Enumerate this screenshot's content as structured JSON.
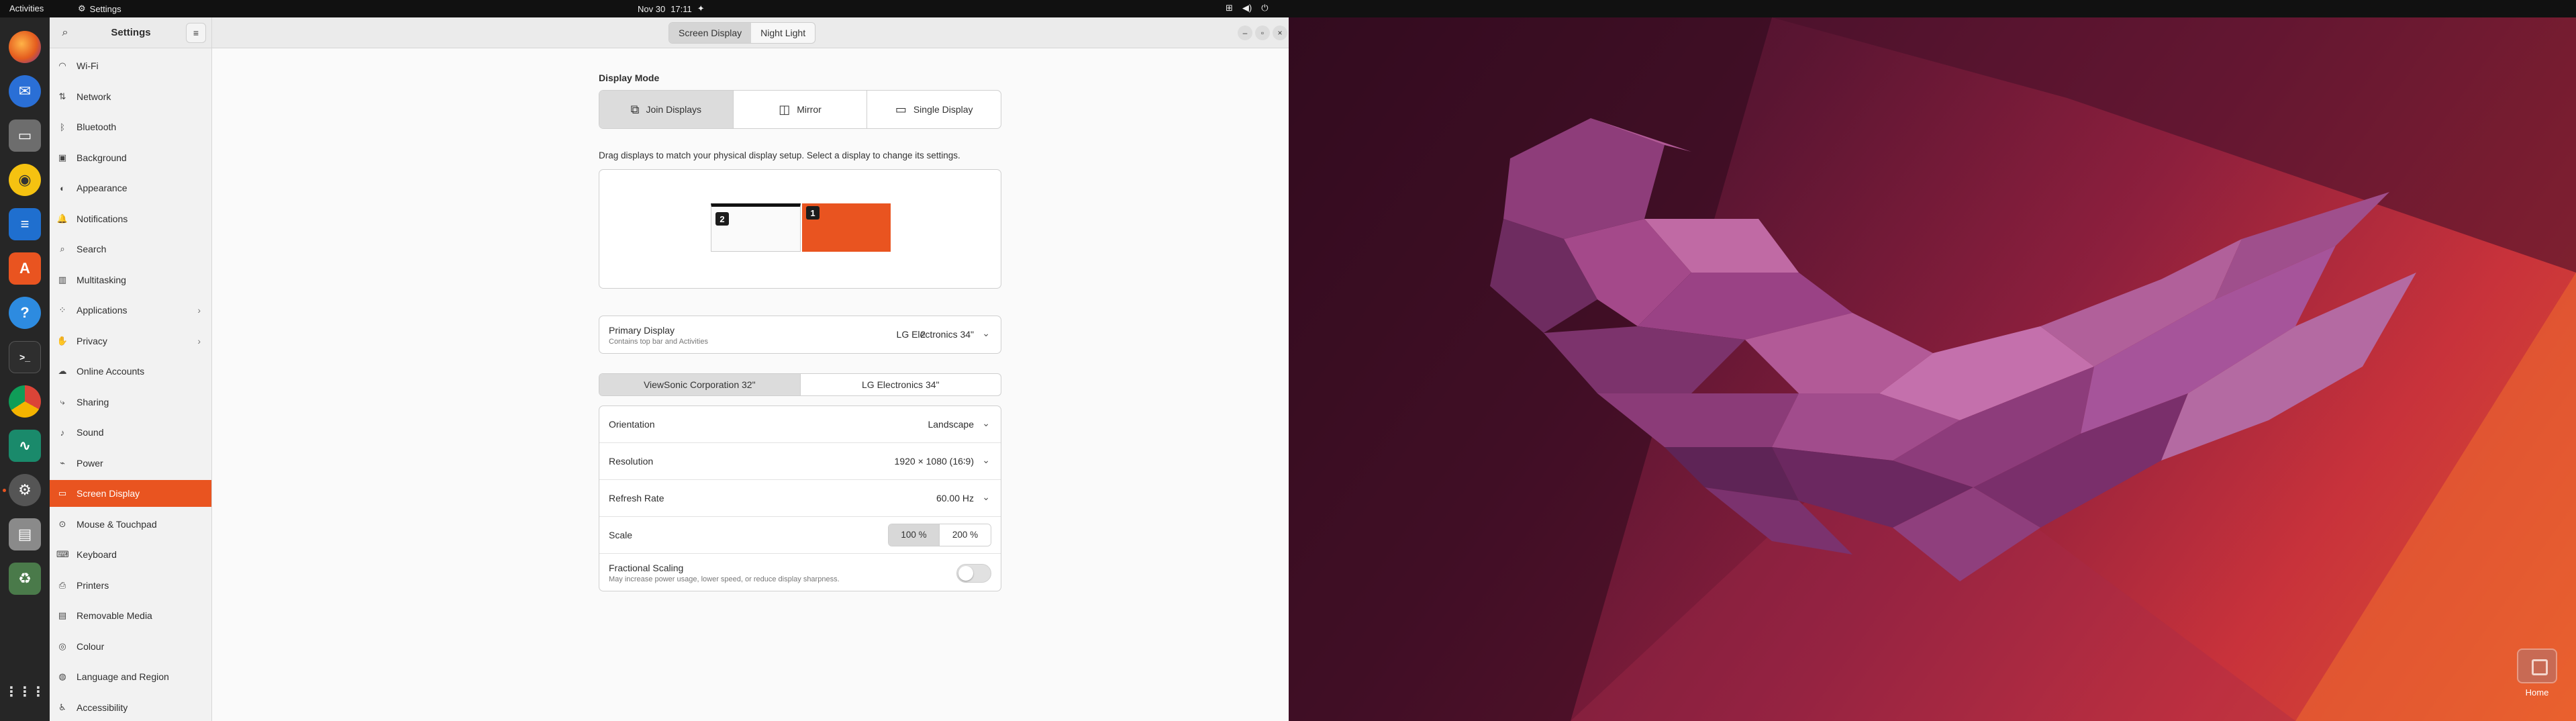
{
  "topbar": {
    "activities": "Activities",
    "app_name": "Settings",
    "app_icon": "gear-icon",
    "date": "Nov 30",
    "time": "17:11",
    "tray_icons": [
      "network-icon",
      "volume-icon",
      "power-icon"
    ]
  },
  "dock": {
    "items": [
      "firefox",
      "thunderbird",
      "files",
      "rhythmbox",
      "libreoffice-writer",
      "app-center",
      "help",
      "terminal",
      "chrome",
      "system-monitor",
      "settings",
      "disk",
      "trash"
    ],
    "apps_grid_icon": "apps-grid-icon"
  },
  "sidebar": {
    "title": "Settings",
    "items": [
      {
        "label": "Wi-Fi",
        "icon": "wifi-icon"
      },
      {
        "label": "Network",
        "icon": "network-icon"
      },
      {
        "label": "Bluetooth",
        "icon": "bluetooth-icon"
      },
      {
        "label": "Background",
        "icon": "background-icon"
      },
      {
        "label": "Appearance",
        "icon": "appearance-icon"
      },
      {
        "label": "Notifications",
        "icon": "bell-icon"
      },
      {
        "label": "Search",
        "icon": "search-icon"
      },
      {
        "label": "Multitasking",
        "icon": "multitasking-icon"
      },
      {
        "label": "Applications",
        "icon": "apps-icon",
        "chevron": true
      },
      {
        "label": "Privacy",
        "icon": "privacy-icon",
        "chevron": true
      },
      {
        "label": "Online Accounts",
        "icon": "cloud-icon"
      },
      {
        "label": "Sharing",
        "icon": "share-icon"
      },
      {
        "label": "Sound",
        "icon": "music-icon"
      },
      {
        "label": "Power",
        "icon": "power-icon"
      },
      {
        "label": "Screen Display",
        "icon": "display-icon",
        "active": true
      },
      {
        "label": "Mouse & Touchpad",
        "icon": "mouse-icon"
      },
      {
        "label": "Keyboard",
        "icon": "keyboard-icon"
      },
      {
        "label": "Printers",
        "icon": "printer-icon"
      },
      {
        "label": "Removable Media",
        "icon": "media-icon"
      },
      {
        "label": "Colour",
        "icon": "colour-icon"
      },
      {
        "label": "Language and Region",
        "icon": "globe-icon"
      },
      {
        "label": "Accessibility",
        "icon": "accessibility-icon"
      }
    ]
  },
  "header": {
    "tabs": [
      {
        "label": "Screen Display",
        "active": true
      },
      {
        "label": "Night Light",
        "active": false
      }
    ]
  },
  "content": {
    "display_mode_title": "Display Mode",
    "modes": [
      {
        "label": "Join Displays",
        "active": true
      },
      {
        "label": "Mirror",
        "active": false
      },
      {
        "label": "Single Display",
        "active": false
      }
    ],
    "hint": "Drag displays to match your physical display setup. Select a display to change its settings.",
    "monitors": [
      {
        "number": "2"
      },
      {
        "number": "1"
      }
    ],
    "primary": {
      "label": "Primary Display",
      "sub": "Contains top bar and Activities",
      "number": "2",
      "value": "LG Electronics 34\""
    },
    "display_tabs": [
      {
        "label": "ViewSonic Corporation 32\"",
        "active": true
      },
      {
        "label": "LG Electronics 34\"",
        "active": false
      }
    ],
    "settings": {
      "orientation": {
        "label": "Orientation",
        "value": "Landscape"
      },
      "resolution": {
        "label": "Resolution",
        "value": "1920 × 1080 (16∶9)"
      },
      "refresh": {
        "label": "Refresh Rate",
        "value": "60.00 Hz"
      },
      "scale": {
        "label": "Scale",
        "options": [
          "100 %",
          "200 %"
        ],
        "selected": "100 %"
      },
      "fractional": {
        "label": "Fractional Scaling",
        "sub": "May increase power usage, lower speed, or reduce display sharpness.",
        "enabled": false
      }
    }
  },
  "desktop": {
    "home_label": "Home"
  },
  "colors": {
    "accent": "#e95420",
    "topbar": "#111111",
    "dock": "#262626"
  }
}
